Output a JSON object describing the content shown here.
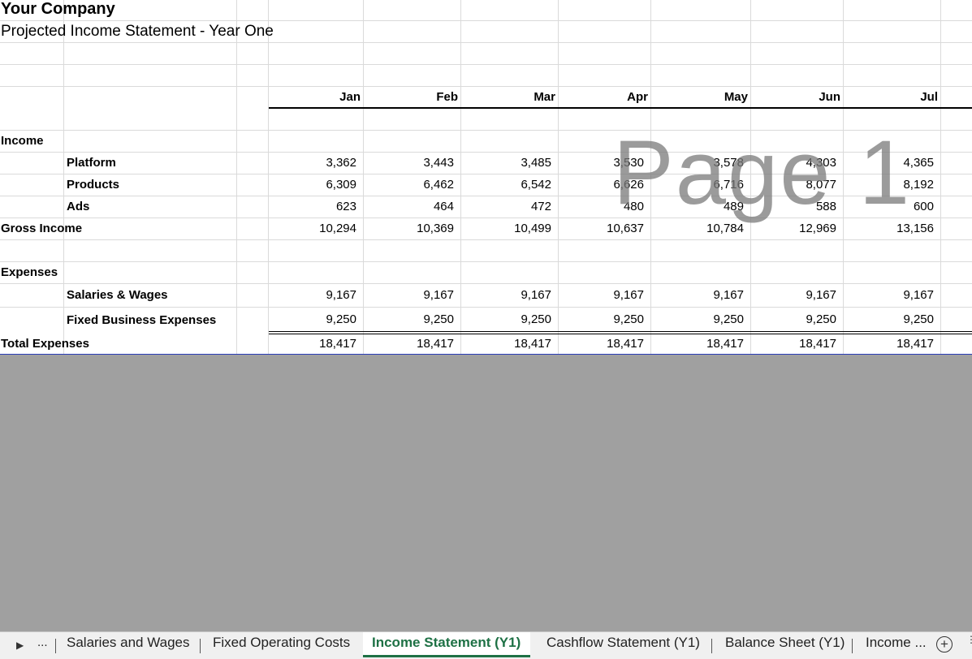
{
  "header": {
    "company": "Your Company",
    "subtitle": "Projected Income Statement - Year One"
  },
  "months": [
    "Jan",
    "Feb",
    "Mar",
    "Apr",
    "May",
    "Jun",
    "Jul"
  ],
  "sections": {
    "income_label": "Income",
    "expenses_label": "Expenses"
  },
  "income_rows": [
    {
      "label": "Platform",
      "values": [
        "3,362",
        "3,443",
        "3,485",
        "3,530",
        "3,578",
        "4,303",
        "4,365"
      ]
    },
    {
      "label": "Products",
      "values": [
        "6,309",
        "6,462",
        "6,542",
        "6,626",
        "6,716",
        "8,077",
        "8,192"
      ]
    },
    {
      "label": "Ads",
      "values": [
        "623",
        "464",
        "472",
        "480",
        "489",
        "588",
        "600"
      ]
    }
  ],
  "gross_income": {
    "label": "Gross Income",
    "values": [
      "10,294",
      "10,369",
      "10,499",
      "10,637",
      "10,784",
      "12,969",
      "13,156"
    ]
  },
  "expense_rows": [
    {
      "label": "Salaries & Wages",
      "values": [
        "9,167",
        "9,167",
        "9,167",
        "9,167",
        "9,167",
        "9,167",
        "9,167"
      ]
    },
    {
      "label": "Fixed Business Expenses",
      "values": [
        "9,250",
        "9,250",
        "9,250",
        "9,250",
        "9,250",
        "9,250",
        "9,250"
      ]
    }
  ],
  "total_expenses": {
    "label": "Total Expenses",
    "values": [
      "18,417",
      "18,417",
      "18,417",
      "18,417",
      "18,417",
      "18,417",
      "18,417"
    ]
  },
  "watermark": "Page 1",
  "tabs": {
    "ellipsis": "...",
    "items": [
      "Salaries and Wages",
      "Fixed Operating Costs",
      "Income Statement (Y1)",
      "Cashflow Statement (Y1)",
      "Balance Sheet (Y1)",
      "Income ..."
    ],
    "active_index": 2,
    "add": "+"
  },
  "colors": {
    "active_tab": "#1e7145",
    "total_border": "#2a3cb8",
    "background": "#a0a0a0"
  }
}
